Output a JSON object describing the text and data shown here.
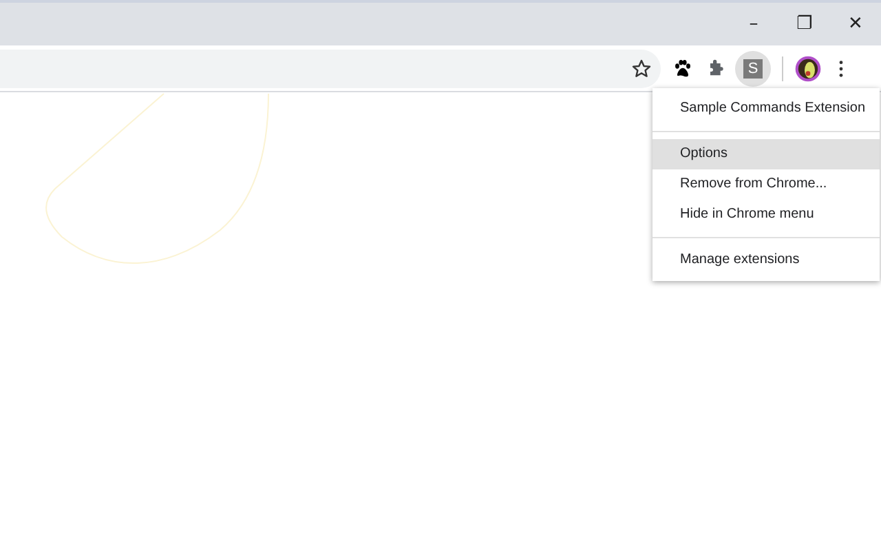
{
  "window": {
    "controls": [
      "–",
      "❐",
      "✕"
    ]
  },
  "extension_badge": "S",
  "context_menu": {
    "items": [
      {
        "kind": "header",
        "label": "Sample Commands Extension",
        "selected": false
      },
      {
        "kind": "separator"
      },
      {
        "kind": "item",
        "label": "Options",
        "selected": true
      },
      {
        "kind": "item",
        "label": "Remove from Chrome...",
        "selected": false
      },
      {
        "kind": "item",
        "label": "Hide in Chrome menu",
        "selected": false
      },
      {
        "kind": "separator"
      },
      {
        "kind": "item",
        "label": "Manage extensions",
        "selected": false
      }
    ]
  }
}
